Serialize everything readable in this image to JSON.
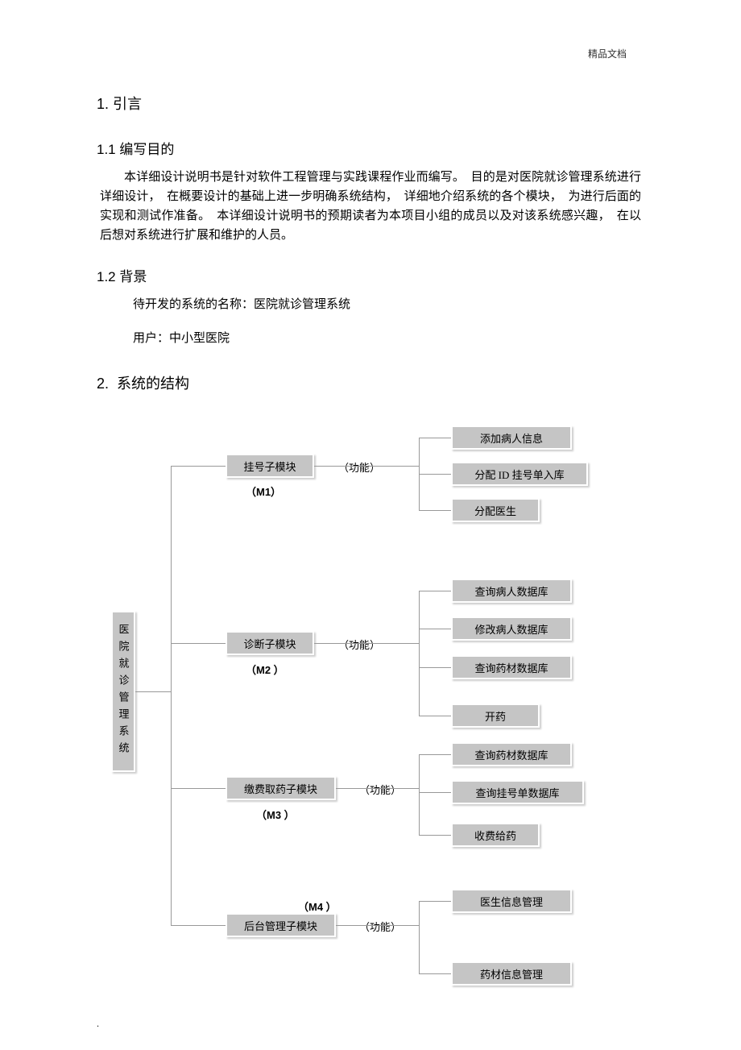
{
  "header": {
    "tag": "精品文档"
  },
  "sections": {
    "s1": {
      "number": "1.",
      "title": "引言"
    },
    "s1_1": {
      "number": "1.1",
      "title": "编写目的",
      "paragraph": "本详细设计说明书是针对软件工程管理与实践课程作业而编写。　目的是对医院就诊管理系统进行详细设计，　在概要设计的基础上进一步明确系统结构，　详细地介绍系统的各个模块，　为进行后面的实现和测试作准备。　本详细设计说明书的预期读者为本项目小组的成员以及对该系统感兴趣，　在以后想对系统进行扩展和维护的人员。"
    },
    "s1_2": {
      "number": "1.2",
      "title": "背景",
      "line1": "待开发的系统的名称：医院就诊管理系统",
      "line2": "用户：中小型医院"
    },
    "s2": {
      "number": "2.",
      "title": "系统的结构"
    }
  },
  "diagram": {
    "root": "医院就诊管理系统",
    "func_label": "（功能）",
    "modules": {
      "m1": {
        "title": "挂号子模块",
        "code": "（M1）",
        "items": [
          "添加病人信息",
          "分配 ID  挂号单入库",
          "分配医生"
        ]
      },
      "m2": {
        "title": "诊断子模块",
        "code": "（M2 ）",
        "items": [
          "查询病人数据库",
          "修改病人数据库",
          "查询药材数据库",
          "开药"
        ]
      },
      "m3": {
        "title": "缴费取药子模块",
        "code": "（M3 ）",
        "items": [
          "查询药材数据库",
          "查询挂号单数据库",
          "收费给药"
        ]
      },
      "m4": {
        "title": "后台管理子模块",
        "code": "（M4 ）",
        "items": [
          "医生信息管理",
          "药材信息管理"
        ]
      }
    }
  }
}
